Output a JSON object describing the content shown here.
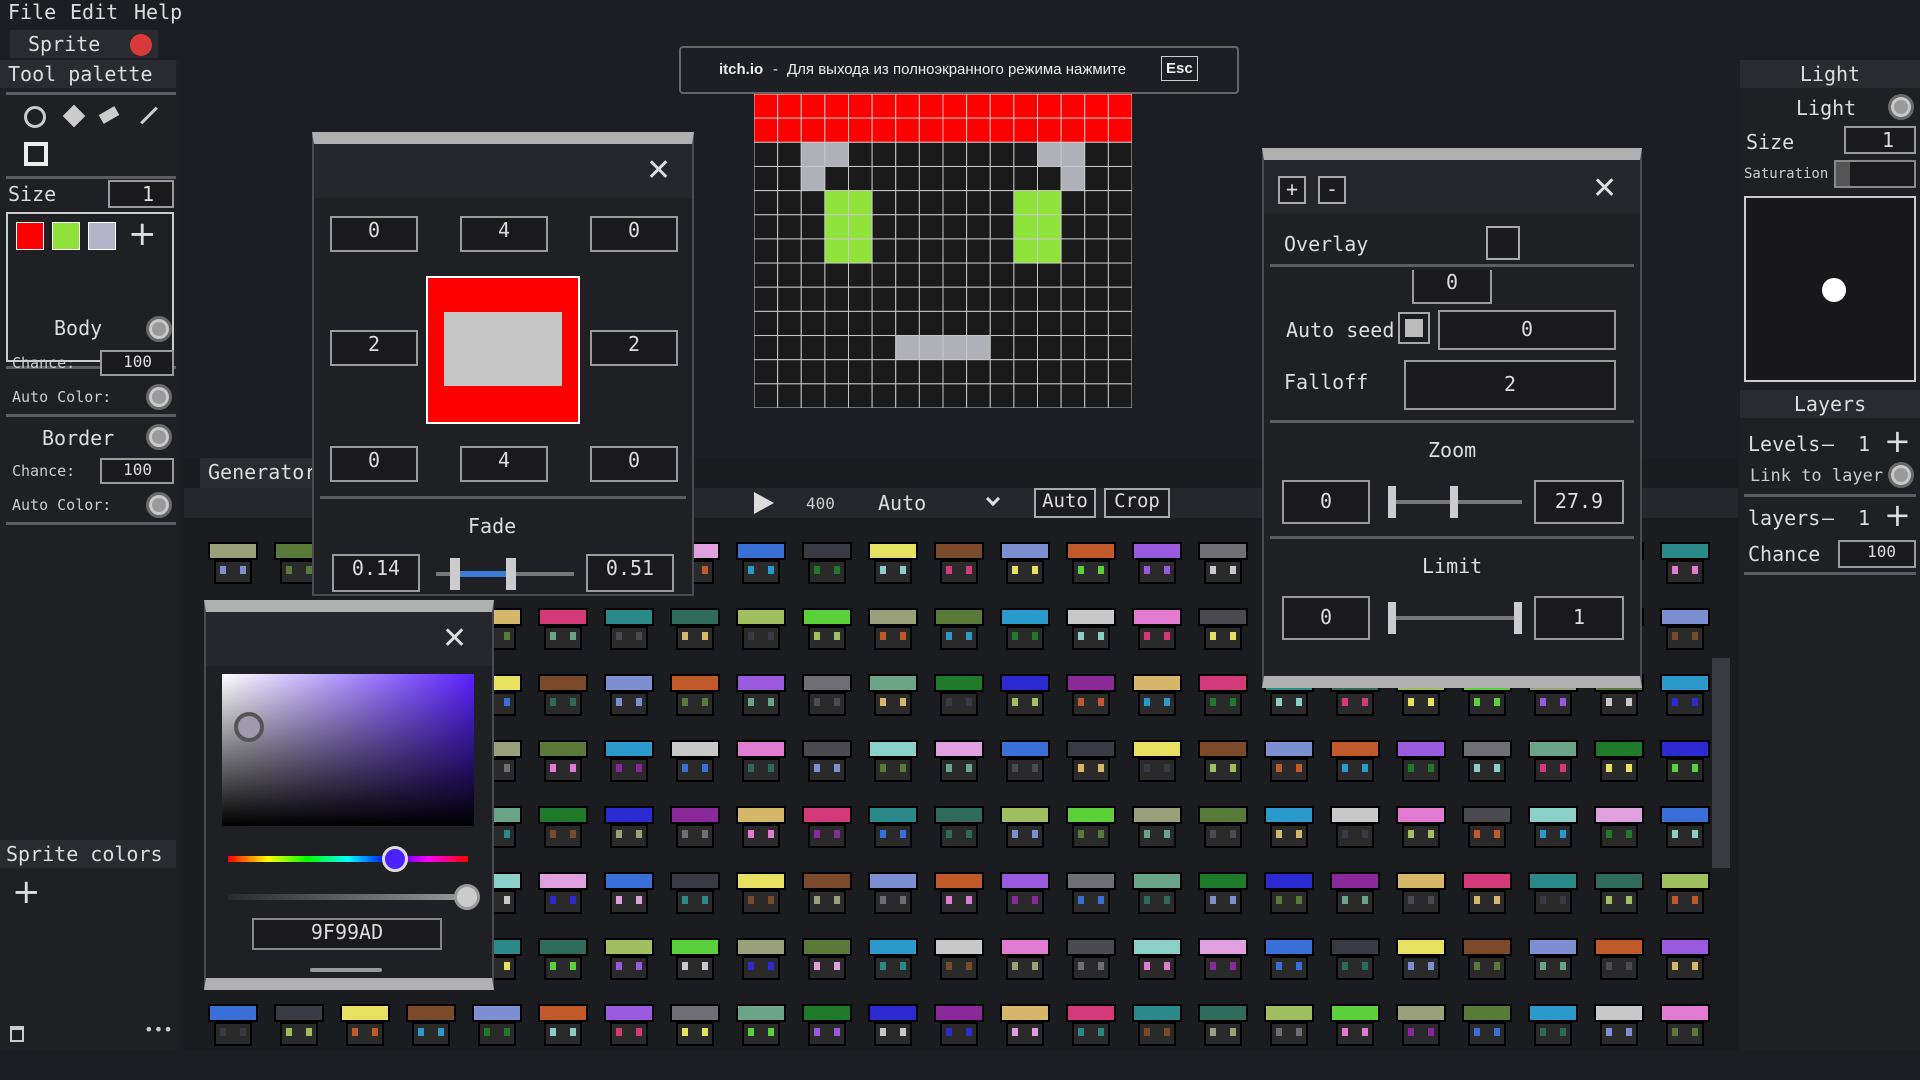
{
  "menu": {
    "file": "File",
    "edit": "Edit",
    "help": "Help"
  },
  "tab": {
    "label": "Sprite"
  },
  "toast": {
    "site": "itch.io",
    "dash": "-",
    "message": "Для выхода из полноэкранного режима нажмите",
    "key": "Esc"
  },
  "tool_palette": {
    "title": "Tool palette",
    "size_label": "Size",
    "size_value": "1",
    "colors": [
      "#ff0000",
      "#8fe33b",
      "#b4b4c8"
    ],
    "add": "+"
  },
  "body_section": {
    "title": "Body",
    "chance_label": "Chance:",
    "chance_value": "100",
    "auto_color_label": "Auto Color:"
  },
  "border_section": {
    "title": "Border",
    "chance_label": "Chance:",
    "chance_value": "100",
    "auto_color_label": "Auto Color:"
  },
  "sprite_colors": {
    "title": "Sprite colors",
    "add": "+",
    "more": "•••"
  },
  "generator": {
    "title": "Generator",
    "speed": "400",
    "mode": "Auto",
    "auto_btn": "Auto",
    "crop_btn": "Crop"
  },
  "margins_window": {
    "top": [
      "0",
      "4",
      "0"
    ],
    "middle": [
      "2",
      "2"
    ],
    "bottom": [
      "0",
      "4",
      "0"
    ],
    "fade_label": "Fade",
    "fade_min": "0.14",
    "fade_max": "0.51"
  },
  "color_picker": {
    "hex": "9F99AD"
  },
  "overlay_window": {
    "plus": "+",
    "minus": "-",
    "overlay_label": "Overlay",
    "seed_value": "0",
    "auto_seed_label": "Auto seed",
    "auto_seed_value": "0",
    "falloff_label": "Falloff",
    "falloff_value": "2",
    "zoom_label": "Zoom",
    "zoom_min": "0",
    "zoom_max": "27.9",
    "limit_label": "Limit",
    "limit_min": "0",
    "limit_max": "1"
  },
  "light_panel": {
    "header": "Light",
    "light_label": "Light",
    "size_label": "Size",
    "size_value": "1",
    "saturation_label": "Saturation"
  },
  "layers_panel": {
    "header": "Layers",
    "levels_label": "Levels",
    "levels_value": "1",
    "link_label": "Link to layer",
    "layers_label": "layers",
    "layers_value": "1",
    "chance_label": "Chance",
    "chance_value": "100",
    "minus": "—",
    "plus": "+"
  }
}
